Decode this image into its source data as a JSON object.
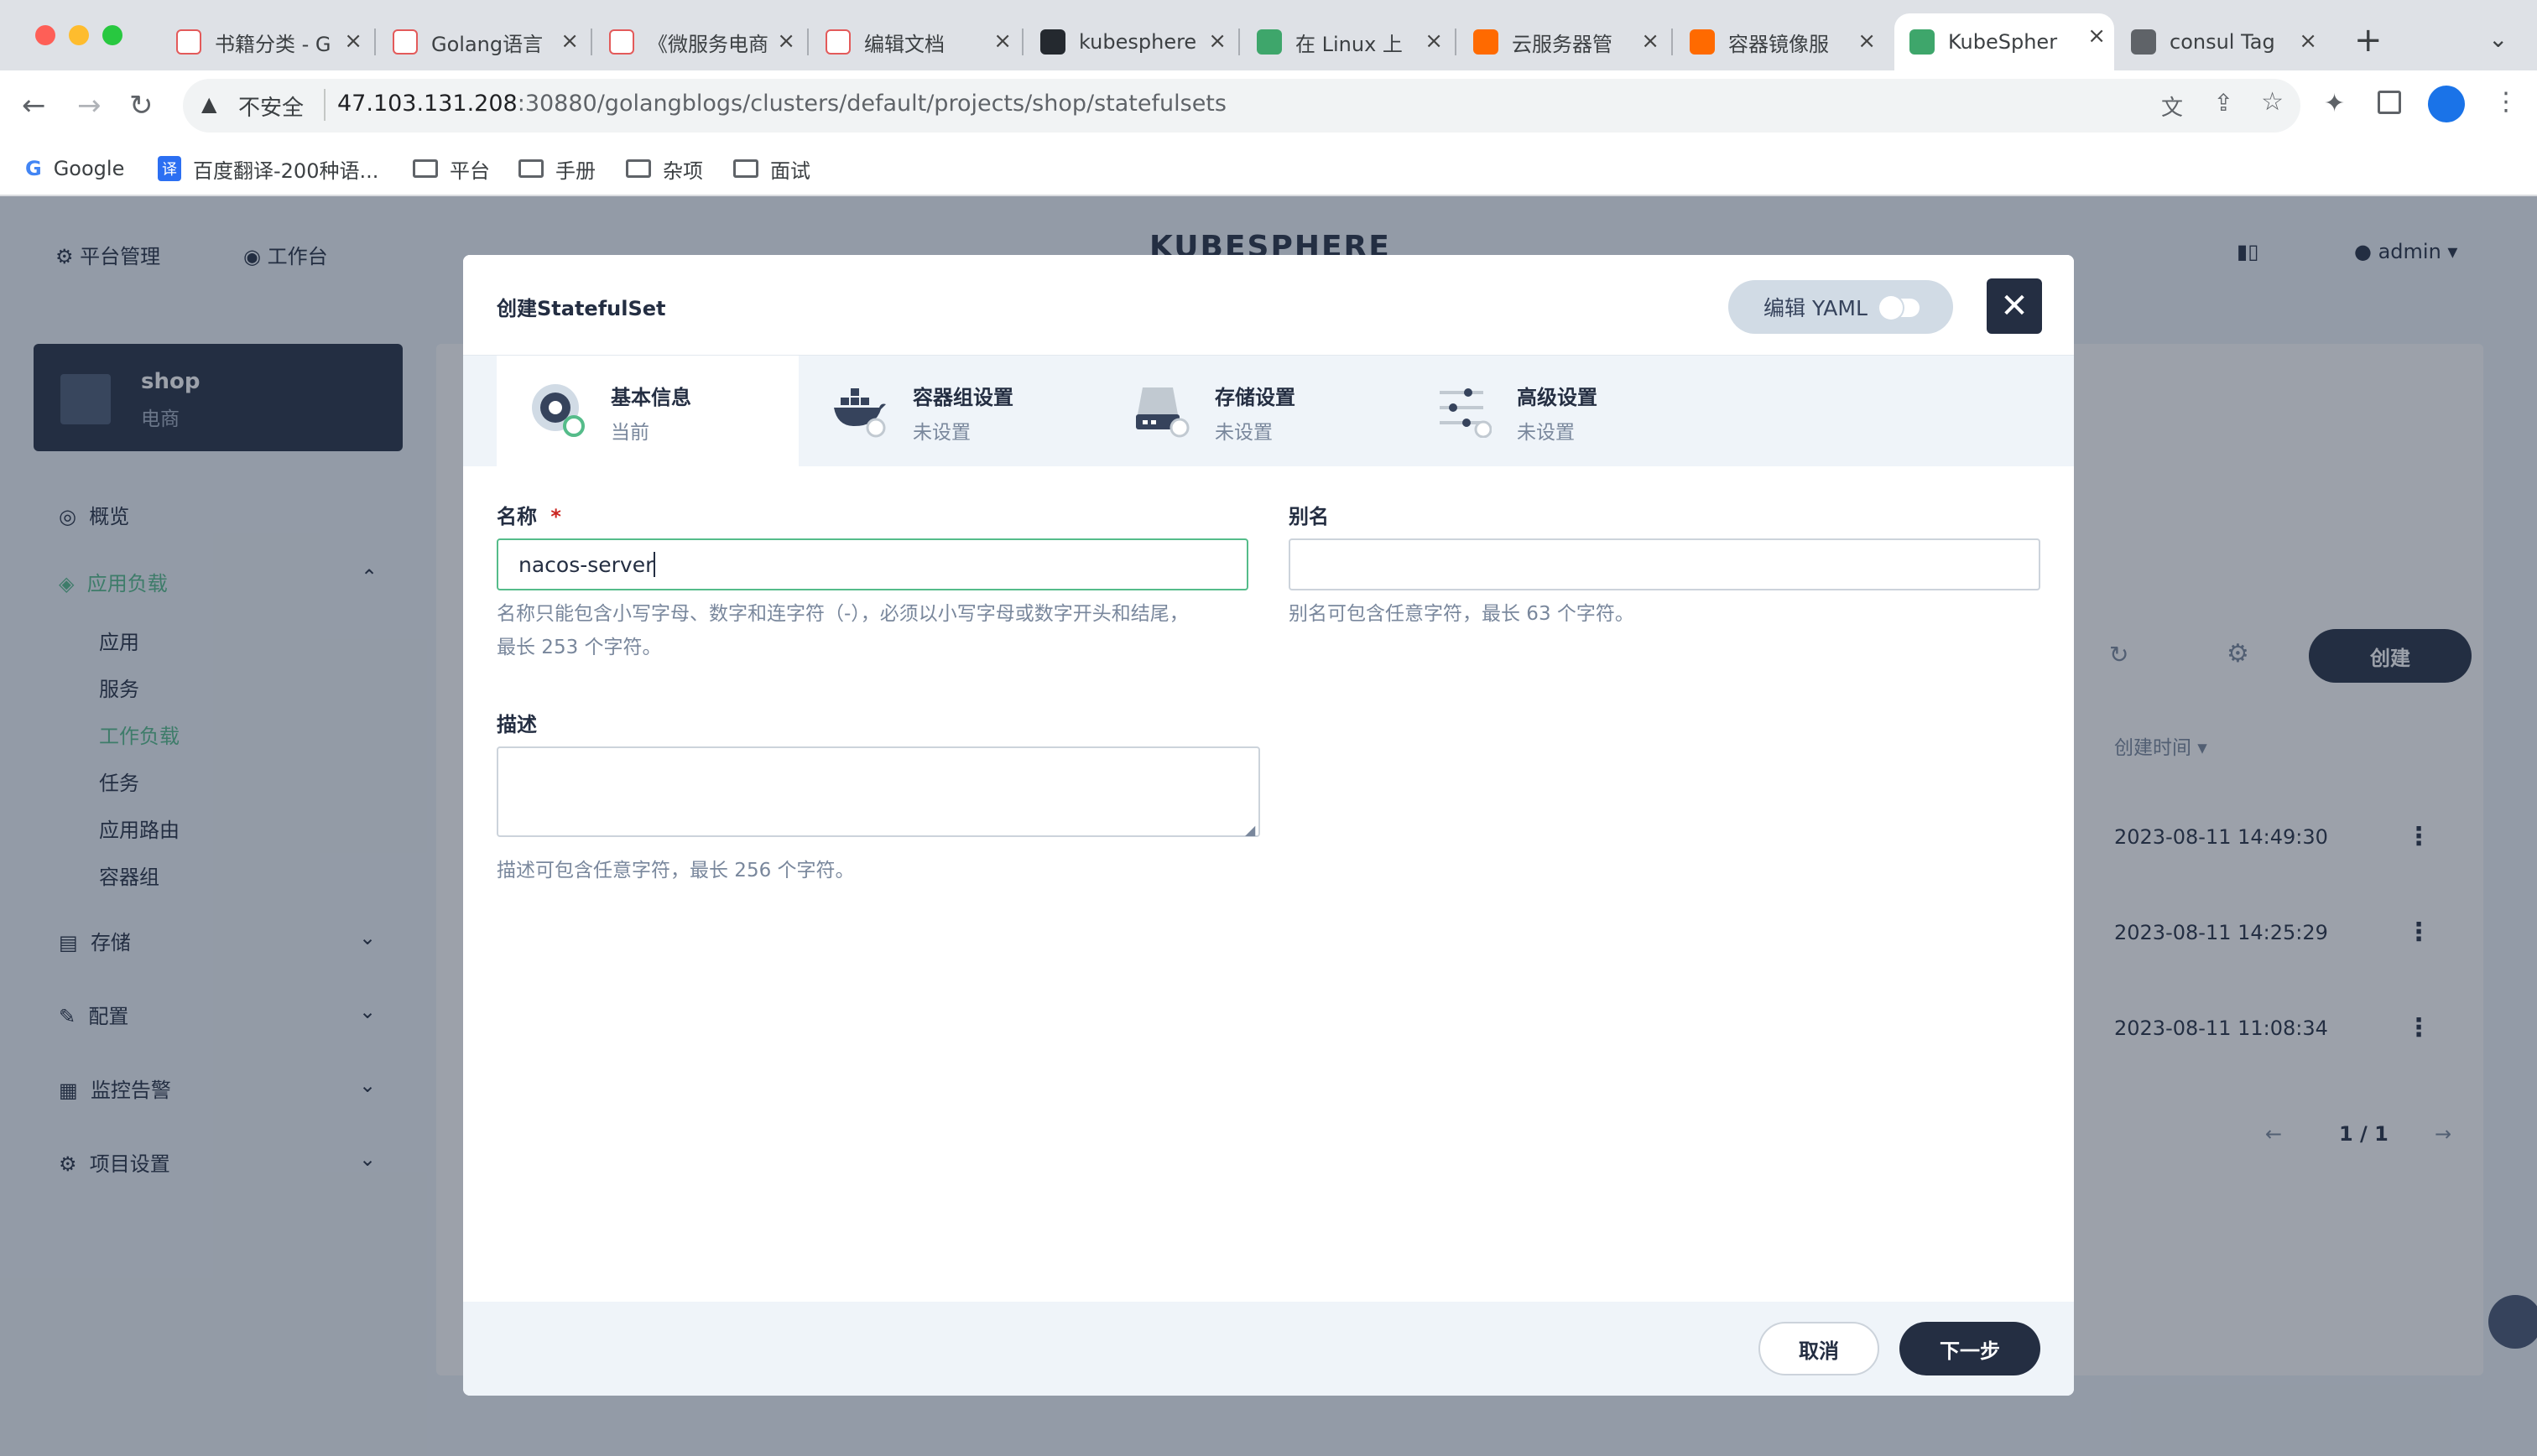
{
  "browser": {
    "tabs": [
      {
        "title": "书籍分类 - G",
        "icon": "doc-icon"
      },
      {
        "title": "Golang语言",
        "icon": "doc-icon"
      },
      {
        "title": "《微服务电商",
        "icon": "doc-icon"
      },
      {
        "title": "编辑文档",
        "icon": "doc-icon"
      },
      {
        "title": "kubesphere",
        "icon": "github-icon"
      },
      {
        "title": "在 Linux 上",
        "icon": "kubesphere-icon"
      },
      {
        "title": "云服务器管",
        "icon": "aliyun-icon"
      },
      {
        "title": "容器镜像服",
        "icon": "aliyun-icon"
      },
      {
        "title": "KubeSpher",
        "icon": "kubesphere-icon"
      },
      {
        "title": "consul Tag",
        "icon": "globe-icon"
      }
    ],
    "security_label": "不安全",
    "url_host": "47.103.131.208",
    "url_rest": ":30880/golangblogs/clusters/default/projects/shop/statefulsets",
    "bookmarks": [
      "Google",
      "百度翻译-200种语...",
      "平台",
      "手册",
      "杂项",
      "面试"
    ]
  },
  "app": {
    "top_nav": {
      "platform": "平台管理",
      "workbench": "工作台",
      "logo": "KUBESPHERE",
      "user": "admin"
    },
    "project": {
      "name": "shop",
      "alias": "电商"
    },
    "sidebar": {
      "overview": "概览",
      "app_workloads": "应用负载",
      "sub_items": [
        "应用",
        "服务",
        "工作负载",
        "任务",
        "应用路由",
        "容器组"
      ],
      "storage": "存储",
      "config": "配置",
      "monitoring": "监控告警",
      "project_settings": "项目设置"
    },
    "list": {
      "create_label": "创建",
      "created_time_header": "创建时间",
      "rows": [
        "2023-08-11 14:49:30",
        "2023-08-11 14:25:29",
        "2023-08-11 11:08:34"
      ],
      "pagination": "1 / 1"
    }
  },
  "modal": {
    "title": "创建StatefulSet",
    "yaml_toggle_label": "编辑 YAML",
    "steps": [
      {
        "title": "基本信息",
        "status": "当前"
      },
      {
        "title": "容器组设置",
        "status": "未设置"
      },
      {
        "title": "存储设置",
        "status": "未设置"
      },
      {
        "title": "高级设置",
        "status": "未设置"
      }
    ],
    "form": {
      "name_label": "名称",
      "required_mark": "*",
      "name_value": "nacos-server",
      "name_help_1": "名称只能包含小写字母、数字和连字符（-），必须以小写字母或数字开头和结尾，",
      "name_help_2": "最长 253 个字符。",
      "alias_label": "别名",
      "alias_value": "",
      "alias_help": "别名可包含任意字符，最长 63 个字符。",
      "desc_label": "描述",
      "desc_value": "",
      "desc_help": "描述可包含任意字符，最长 256 个字符。"
    },
    "cancel_label": "取消",
    "next_label": "下一步"
  },
  "colors": {
    "accent_green": "#55bc8a",
    "dark": "#242e42",
    "muted": "#79879c"
  }
}
